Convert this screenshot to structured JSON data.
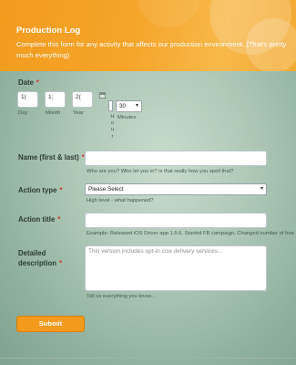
{
  "header": {
    "title": "Production Log",
    "description": "Complete this form for any activity that affects our production environment. (That's pretty much everything)"
  },
  "date": {
    "label": "Date",
    "day_value": "1(",
    "month_value": "1;",
    "year_value": "2(",
    "day_label": "Day",
    "month_label": "Month",
    "year_label": "Year",
    "hour_label_letters": [
      "H",
      "o",
      "u",
      "r"
    ],
    "minutes_value": "30",
    "minutes_label": "Minutes"
  },
  "name": {
    "label": "Name (first & last)",
    "hint": "Who are you? Who let you in? is that really how you spell that?"
  },
  "action_type": {
    "label": "Action type",
    "selected": "Please Select",
    "hint": "High level - what happened?"
  },
  "action_title": {
    "label": "Action title",
    "hint": "Example: Released iOS Driver app 1.5.6, Started FB campaign, Changed number of free rid"
  },
  "detailed_description": {
    "label_line1": "Detailed",
    "label_line2": "description",
    "placeholder": "This version includes opt-in cow delivery services...",
    "hint": "Tell us everything you know..."
  },
  "required_marker": "*",
  "submit_label": "Submit",
  "colors": {
    "accent": "#f39a1d",
    "required": "#d33a2c"
  }
}
